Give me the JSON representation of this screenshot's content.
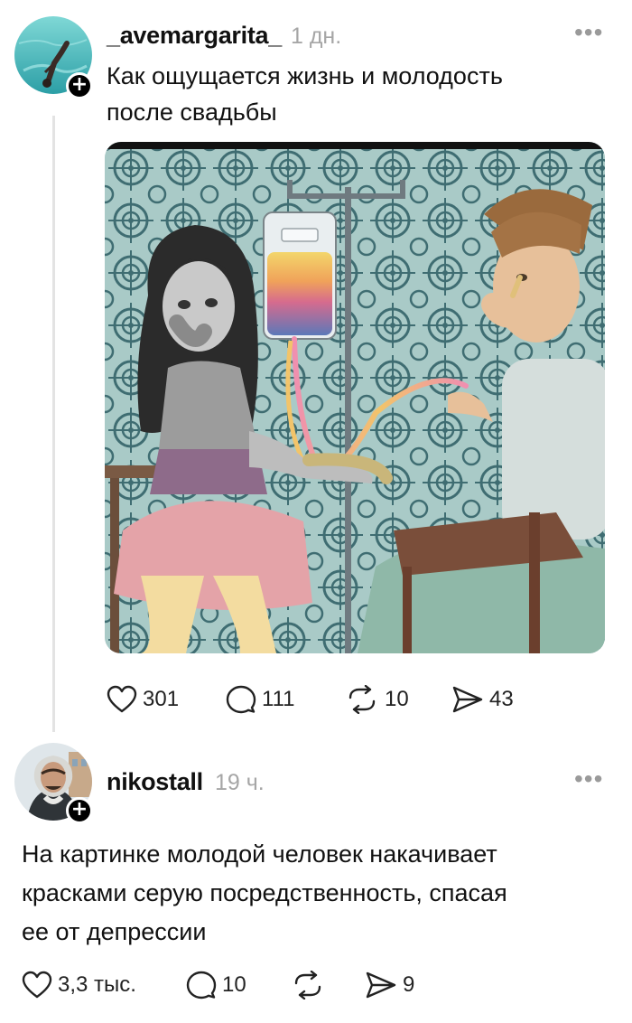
{
  "posts": [
    {
      "username": "_avemargarita_",
      "time": "1 дн.",
      "text_line1": "Как ощущается жизнь и молодость",
      "text_line2": "после свадьбы",
      "likes": "301",
      "comments": "111",
      "reposts": "10",
      "shares": "43"
    },
    {
      "username": "nikostall",
      "time": "19 ч.",
      "text_line1": "На картинке молодой человек накачивает",
      "text_line2": "красками серую посредственность, спасая",
      "text_line3": "ее от депрессии",
      "likes": "3,3 тыс.",
      "comments": "10",
      "reposts": "",
      "shares": "9"
    }
  ],
  "icons": {
    "like": "heart-icon",
    "comment": "comment-icon",
    "repost": "repost-icon",
    "share": "send-icon",
    "more": "more-icon",
    "follow": "plus-icon"
  },
  "colors": {
    "text": "#111111",
    "muted": "#a6a6a6",
    "thread_line": "#e3e3e3",
    "illustration_bg": "#a8c7c4"
  }
}
